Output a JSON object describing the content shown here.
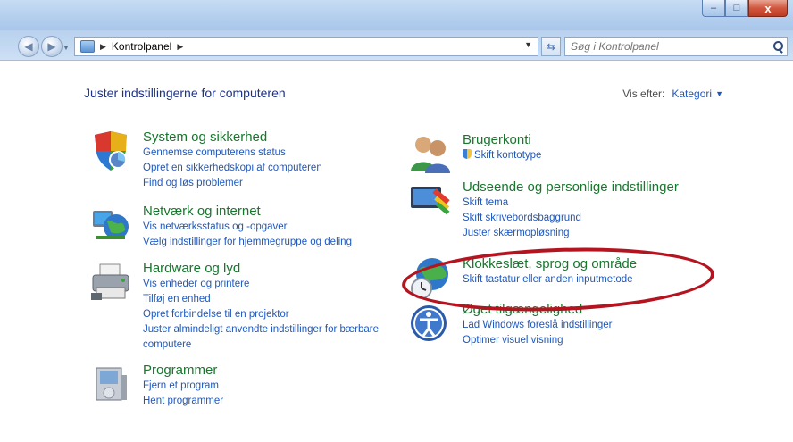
{
  "window": {
    "minimize_glyph": "–",
    "maximize_glyph": "□",
    "close_glyph": "x"
  },
  "address": {
    "breadcrumb": "Kontrolpanel",
    "search_placeholder": "Søg i Kontrolpanel"
  },
  "header": {
    "title": "Juster indstillingerne for computeren",
    "view_by_label": "Vis efter:",
    "view_by_value": "Kategori"
  },
  "left_categories": [
    {
      "icon": "security-shield-icon",
      "title": "System og sikkerhed",
      "links": [
        "Gennemse computerens status",
        "Opret en sikkerhedskopi af computeren",
        "Find og løs problemer"
      ]
    },
    {
      "icon": "network-globe-icon",
      "title": "Netværk og internet",
      "links": [
        "Vis netværksstatus og -opgaver",
        "Vælg indstillinger for hjemmegruppe og deling"
      ]
    },
    {
      "icon": "printer-icon",
      "title": "Hardware og lyd",
      "links": [
        "Vis enheder og printere",
        "Tilføj en enhed",
        "Opret forbindelse til en projektor",
        "Juster almindeligt anvendte indstillinger for bærbare",
        "computere"
      ]
    },
    {
      "icon": "programs-box-icon",
      "title": "Programmer",
      "links": [
        "Fjern et program",
        "Hent programmer"
      ]
    }
  ],
  "right_categories": [
    {
      "icon": "user-accounts-icon",
      "title": "Brugerkonti",
      "links": [
        "Skift kontotype"
      ]
    },
    {
      "icon": "appearance-paintbrush-icon",
      "title": "Udseende og personlige indstillinger",
      "links": [
        "Skift tema",
        "Skift skrivebordsbaggrund",
        "Juster skærmopløsning"
      ]
    },
    {
      "icon": "clock-globe-icon",
      "title": "Klokkeslæt, sprog og område",
      "links": [
        "Skift tastatur eller anden inputmetode"
      ]
    },
    {
      "icon": "ease-of-access-icon",
      "title": "Øget tilgængelighed",
      "links": [
        "Lad Windows foreslå indstillinger",
        "Optimer visuel visning"
      ]
    }
  ],
  "colors": {
    "heading_green": "#17772d",
    "link_blue": "#1f58bd",
    "title_navy": "#1e3287",
    "highlight_oval": "#b4141f"
  }
}
